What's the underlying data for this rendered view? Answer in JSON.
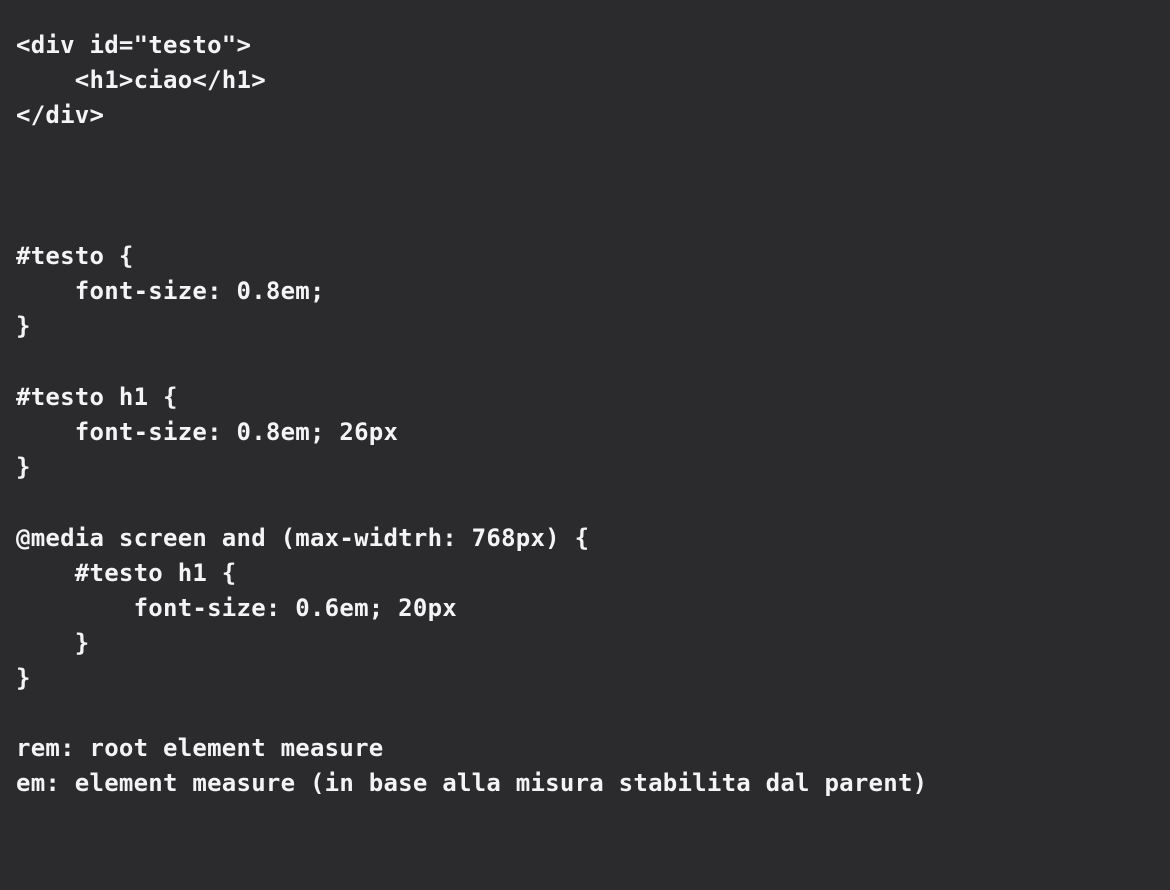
{
  "code_lines": [
    "<div id=\"testo\">",
    "    <h1>ciao</h1>",
    "</div>",
    "#testo {",
    "    font-size: 0.8em;",
    "}",
    "#testo h1 {",
    "    font-size: 0.8em; 26px",
    "}",
    "@media screen and (max-widtrh: 768px) {",
    "    #testo h1 {",
    "        font-size: 0.6em; 20px",
    "    }",
    "}",
    "rem: root element measure",
    "em: element measure (in base alla misura stabilita dal parent)"
  ]
}
